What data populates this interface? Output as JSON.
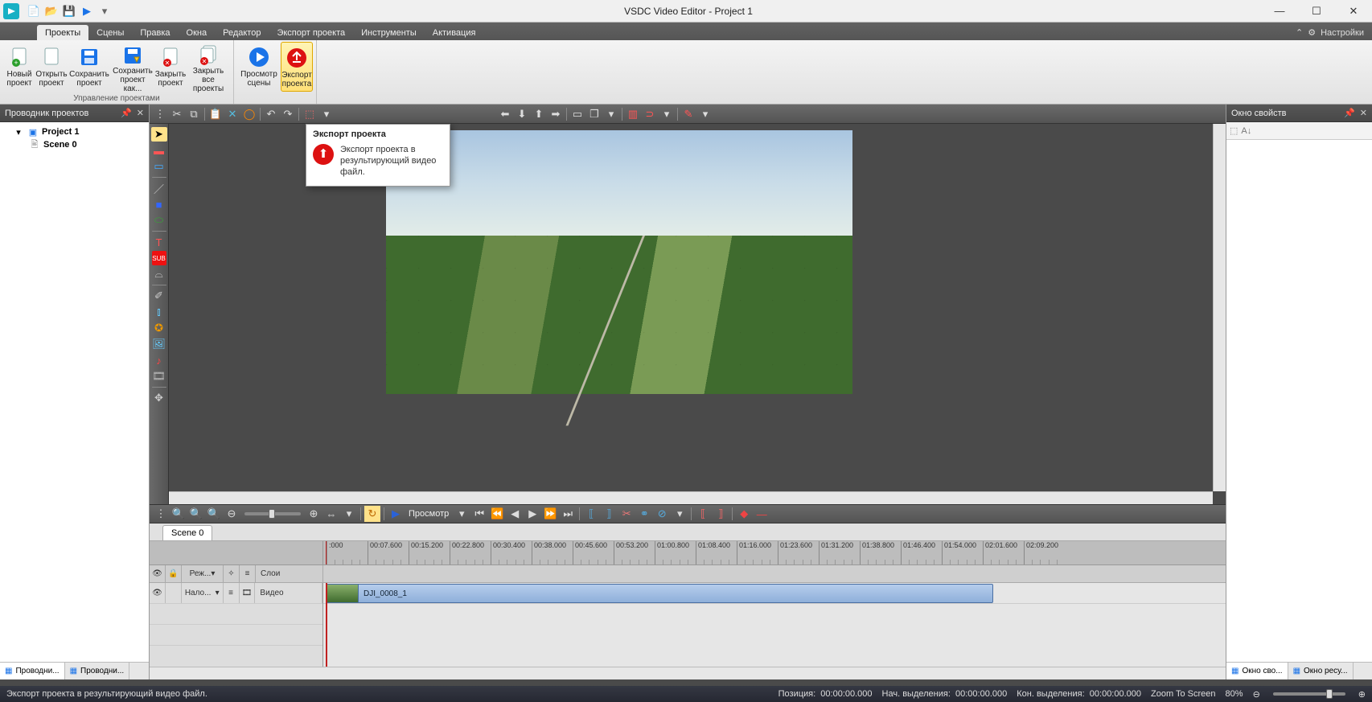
{
  "app": {
    "title": "VSDC Video Editor - Project 1"
  },
  "qat": [
    "new",
    "open",
    "save",
    "play",
    "menu"
  ],
  "tabs": {
    "items": [
      "Проекты",
      "Сцены",
      "Правка",
      "Окна",
      "Редактор",
      "Экспорт проекта",
      "Инструменты",
      "Активация"
    ],
    "active": 0
  },
  "settings_label": "Настройки",
  "ribbon": {
    "group1_cap": "Управление проектами",
    "new": "Новый\nпроект",
    "open": "Открыть\nпроект",
    "save": "Сохранить\nпроект",
    "saveas": "Сохранить\nпроект как...",
    "close": "Закрыть\nпроект",
    "closeall": "Закрыть все\nпроекты",
    "preview": "Просмотр\nсцены",
    "export": "Экспорт\nпроекта"
  },
  "tooltip": {
    "title": "Экспорт проекта",
    "body": "Экспорт проекта в результирующий видео файл."
  },
  "left": {
    "title": "Проводник проектов",
    "project": "Project 1",
    "scene": "Scene 0",
    "tab1": "Проводни...",
    "tab2": "Проводни..."
  },
  "right": {
    "title": "Окно свойств",
    "tab1": "Окно сво...",
    "tab2": "Окно ресу..."
  },
  "playbar": {
    "preview_label": "Просмотр"
  },
  "scene_tab": "Scene 0",
  "timeline": {
    "ticks": [
      ":000",
      "00:07.600",
      "00:15.200",
      "00:22.800",
      "00:30.400",
      "00:38.000",
      "00:45.600",
      "00:53.200",
      "01:00.800",
      "01:08.400",
      "01:16.000",
      "01:23.600",
      "01:31.200",
      "01:38.800",
      "01:46.400",
      "01:54.000",
      "02:01.600",
      "02:09.200"
    ],
    "col_mode": "Реж...",
    "col_layers": "Слои",
    "track_name": "Нало...",
    "track_type": "Видео",
    "clip_name": "DJI_0008_1"
  },
  "status": {
    "msg": "Экспорт проекта в результирующий видео файл.",
    "pos_l": "Позиция:",
    "pos_v": "00:00:00.000",
    "selb_l": "Нач. выделения:",
    "selb_v": "00:00:00.000",
    "sele_l": "Кон. выделения:",
    "sele_v": "00:00:00.000",
    "zoom_l": "Zoom To Screen",
    "zoom_pct": "80%"
  }
}
